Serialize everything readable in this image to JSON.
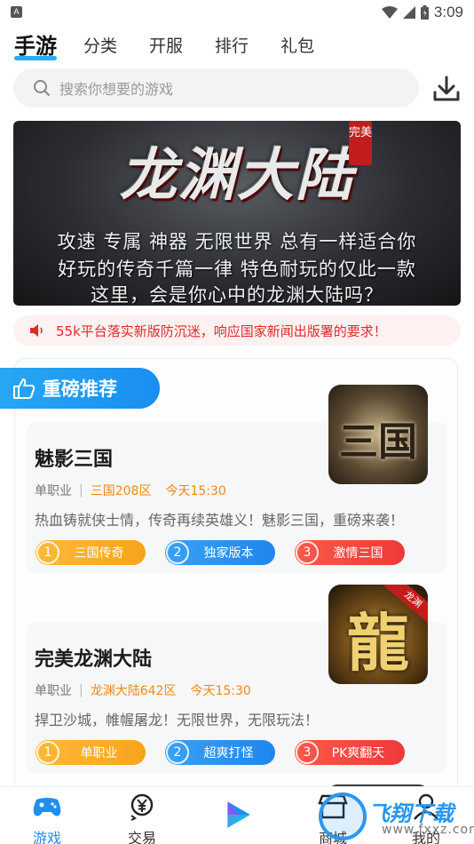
{
  "status_bar": {
    "time": "3:09",
    "app_icon": "A"
  },
  "tabs": [
    {
      "label": "手游",
      "active": true
    },
    {
      "label": "分类",
      "active": false
    },
    {
      "label": "开服",
      "active": false
    },
    {
      "label": "排行",
      "active": false
    },
    {
      "label": "礼包",
      "active": false
    }
  ],
  "search": {
    "placeholder": "搜索你想要的游戏"
  },
  "banner": {
    "logo": "龙渊大陆",
    "seal": "完美",
    "line1": "攻速 专属 神器 无限世界 总有一样适合你",
    "line2": "好玩的传奇千篇一律 特色耐玩的仅此一款",
    "line3": "这里，会是你心中的龙渊大陆吗？"
  },
  "notice": {
    "text": "55k平台落实新版防沉迷，响应国家新闻出版署的要求！"
  },
  "section": {
    "title": "重磅推荐"
  },
  "games": [
    {
      "title": "魅影三国",
      "type": "单职业",
      "server": "三国208区",
      "time": "今天15:30",
      "desc": "热血铸就侠士情，传奇再续英雄义！魅影三国，重磅来袭！",
      "thumb_glyph": "三国",
      "tags": [
        {
          "num": "1",
          "label": "三国传奇",
          "color": "yellow"
        },
        {
          "num": "2",
          "label": "独家版本",
          "color": "blue"
        },
        {
          "num": "3",
          "label": "激情三国",
          "color": "red"
        }
      ]
    },
    {
      "title": "完美龙渊大陆",
      "type": "单职业",
      "server": "龙渊大陆642区",
      "time": "今天15:30",
      "desc": "捍卫沙城，帷幄屠龙！无限世界，无限玩法！",
      "thumb_glyph": "龍",
      "thumb_ribbon": "龙渊",
      "tags": [
        {
          "num": "1",
          "label": "单职业",
          "color": "yellow"
        },
        {
          "num": "2",
          "label": "超爽打怪",
          "color": "blue"
        },
        {
          "num": "3",
          "label": "PK爽翻天",
          "color": "red"
        }
      ]
    }
  ],
  "bottom_nav": [
    {
      "label": "游戏",
      "icon": "gamepad-icon",
      "active": true
    },
    {
      "label": "交易",
      "icon": "yen-exchange-icon",
      "active": false
    },
    {
      "label": "",
      "icon": "play-icon",
      "active": false
    },
    {
      "label": "商城",
      "icon": "store-icon",
      "active": false
    },
    {
      "label": "我的",
      "icon": "user-icon",
      "active": false
    }
  ],
  "watermark": {
    "title": "飞翔下载",
    "url": "www.fxxz.com"
  },
  "colors": {
    "accent": "#1e8ef0",
    "orange": "#f08a10",
    "notice_red": "#e02a2a"
  }
}
